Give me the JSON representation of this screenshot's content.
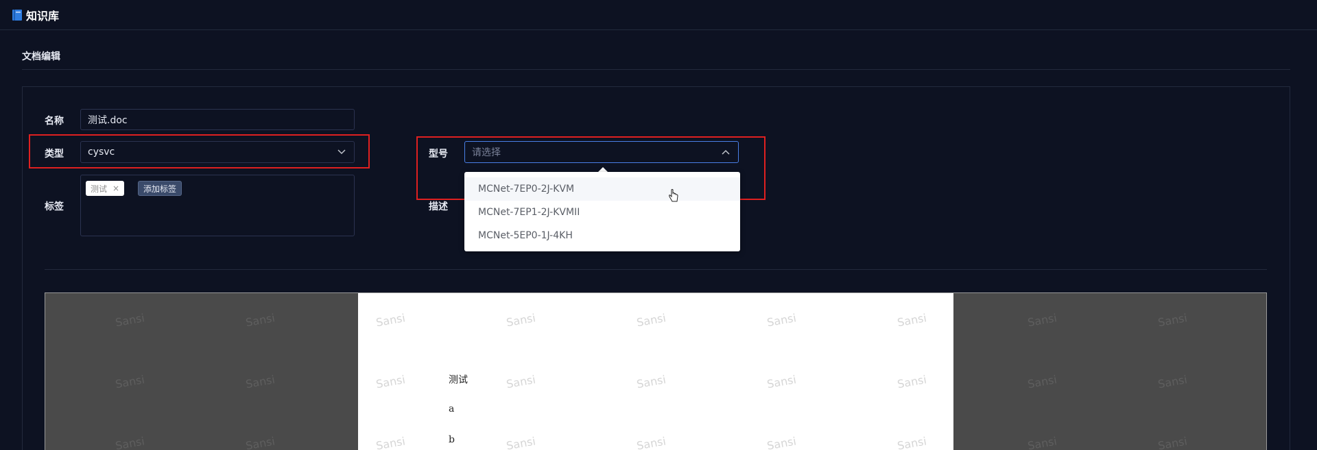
{
  "app": {
    "title": "知识库",
    "icon": "book-icon"
  },
  "section": {
    "title": "文档编辑"
  },
  "form": {
    "name": {
      "label": "名称",
      "value": "测试.doc"
    },
    "type": {
      "label": "类型",
      "value": "cysvc"
    },
    "tags": {
      "label": "标签",
      "items": [
        "测试"
      ],
      "close_glyph": "×",
      "add_label": "添加标签"
    },
    "model": {
      "label": "型号",
      "placeholder": "请选择",
      "options": [
        "MCNet-7EP0-2J-KVM",
        "MCNet-7EP1-2J-KVMII",
        "MCNet-5EP0-1J-4KH"
      ]
    },
    "description": {
      "label": "描述"
    }
  },
  "preview": {
    "watermark": "Sansi",
    "lines": [
      "测试",
      "a",
      "b"
    ]
  },
  "colors": {
    "background": "#0d1222",
    "highlight_border": "#e02020",
    "focus_border": "#4a80e8"
  }
}
